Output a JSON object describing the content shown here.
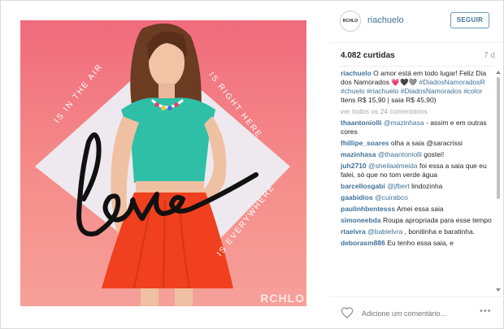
{
  "post": {
    "taglines": {
      "left": "is in the air",
      "right": "is right here",
      "bottom": "is everywhere"
    },
    "script_word": "love",
    "watermark": "RCHLO",
    "necklace_alt": "necklace"
  },
  "header": {
    "avatar_text": "RCHLO",
    "username": "riachuelo",
    "follow_label": "SEGUIR"
  },
  "stats": {
    "likes": "4.082 curtidas",
    "time": "7 d"
  },
  "caption": {
    "user": "riachuelo",
    "text": "O amor está em todo lugar! Feliz Dia dos Namorados 💗🖤🩶",
    "tags": "#DiadosNamoradosR #chuelo #riachuelo #DiadosNamorados #color",
    "details": "Itens R$ 15,90 | saia R$ 45,90)"
  },
  "more_comments": "ver todos os 24 comentários",
  "comments": [
    {
      "user": "thaantoniolli",
      "mention": "@mazinhasa",
      "text": "- assim e em outras cores"
    },
    {
      "user": "fhillipe_soares",
      "mention": "",
      "text": "olha a saia @saracrissi"
    },
    {
      "user": "mazinhasa",
      "mention": "@thaantoniolli",
      "text": "gostei!"
    },
    {
      "user": "juh2710",
      "mention": "@sheilaalmeida",
      "text": "foi essa a saia que eu falei, só que no tom verde água"
    },
    {
      "user": "barcellosgabi",
      "mention": "@jfbert",
      "text": "lindozinha"
    },
    {
      "user": "gaabidios",
      "mention": "@cuirabco",
      "text": ""
    },
    {
      "user": "paulinhbentesss",
      "mention": "",
      "text": "Amei essa saia"
    },
    {
      "user": "simoneebda",
      "mention": "",
      "text": "Roupa apropriada para esse tempo"
    },
    {
      "user": "rtaelvra",
      "mention": "@babielvra",
      "text": ", bonitinha e baratinha."
    },
    {
      "user": "deborasm886",
      "mention": "",
      "text": "Eu tenho essa saia, e"
    }
  ],
  "add_comment": {
    "placeholder": "Adicione um comentário..."
  },
  "icons": {
    "like": "heart-icon",
    "options": "more-options-icon"
  },
  "colors": {
    "link": "#3f729b",
    "background_top": "#f06b7c",
    "background_bottom": "#f6a09a",
    "top": "#2fbfa7",
    "skirt": "#f0401f"
  }
}
